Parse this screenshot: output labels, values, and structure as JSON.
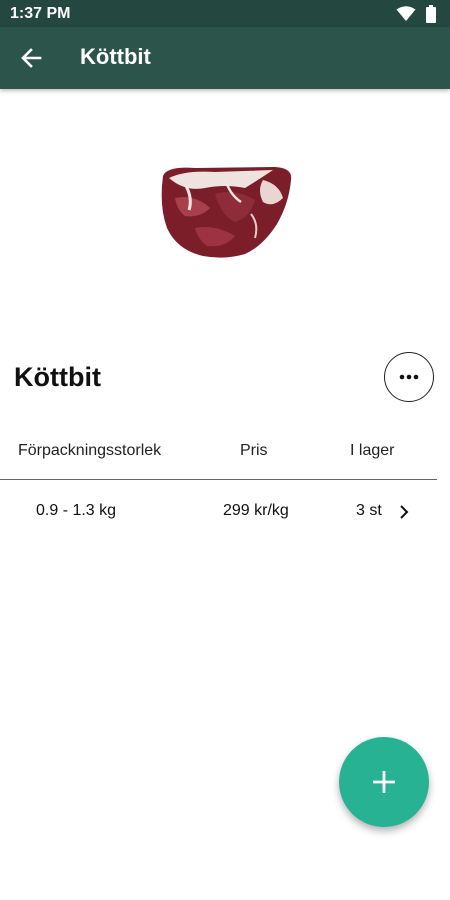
{
  "status_bar": {
    "time": "1:37 PM",
    "icons": [
      "wifi-icon",
      "battery-icon"
    ]
  },
  "app_bar": {
    "title": "Köttbit",
    "back_icon": "arrow-left-icon"
  },
  "product": {
    "name": "Köttbit",
    "image": "meat-piece-image",
    "more_icon": "more-horizontal-icon"
  },
  "table": {
    "headers": [
      "Förpackningsstorlek",
      "Pris",
      "I lager"
    ],
    "rows": [
      {
        "size": "0.9 - 1.3 kg",
        "price": "299 kr/kg",
        "stock": "3 st"
      }
    ]
  },
  "fab": {
    "icon": "plus-icon"
  },
  "colors": {
    "status_bar": "#24473f",
    "app_bar": "#2c544b",
    "fab": "#27b393"
  }
}
